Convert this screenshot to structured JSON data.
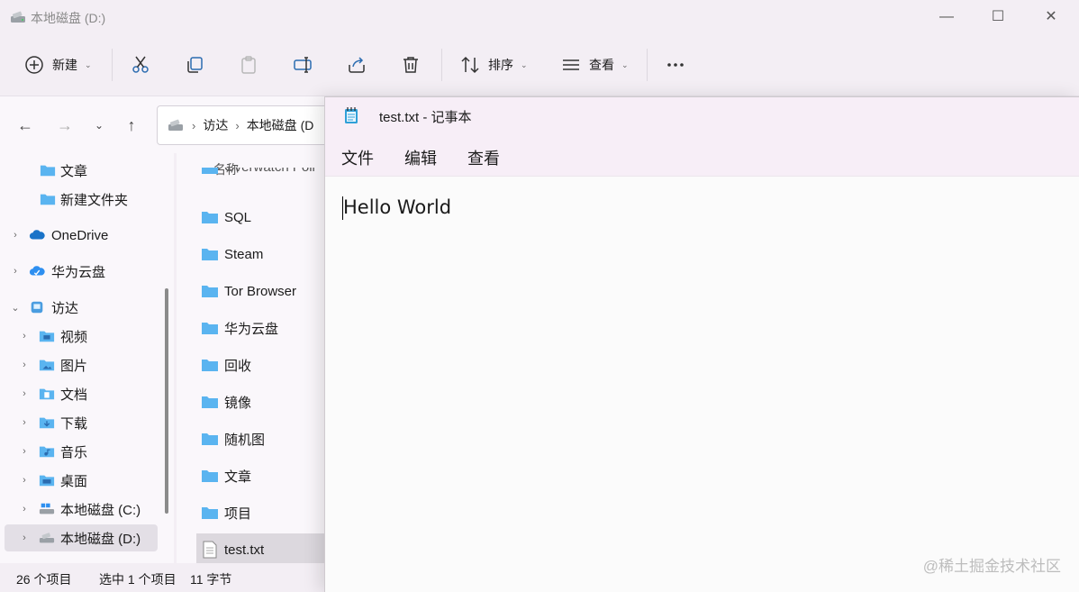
{
  "explorer": {
    "title": "本地磁盘 (D:)",
    "toolbar": {
      "new_label": "新建",
      "sort_label": "排序",
      "view_label": "查看",
      "icons": [
        "plus-circle-icon",
        "cut-icon",
        "copy-icon",
        "paste-icon",
        "rename-icon",
        "share-icon",
        "delete-icon",
        "sort-icon",
        "view-icon",
        "more-icon"
      ]
    },
    "address": {
      "segments": [
        "访达",
        "本地磁盘 (D"
      ]
    },
    "sidebar": {
      "items": [
        {
          "label": "文章",
          "icon": "folder-icon"
        },
        {
          "label": "新建文件夹",
          "icon": "folder-icon"
        },
        {
          "label": "OneDrive",
          "icon": "cloud-icon"
        },
        {
          "label": "华为云盘",
          "icon": "cloud-icon"
        },
        {
          "label": "访达",
          "icon": "computer-icon"
        },
        {
          "label": "视频",
          "icon": "video-folder-icon"
        },
        {
          "label": "图片",
          "icon": "pictures-folder-icon"
        },
        {
          "label": "文档",
          "icon": "documents-folder-icon"
        },
        {
          "label": "下载",
          "icon": "downloads-folder-icon"
        },
        {
          "label": "音乐",
          "icon": "music-folder-icon"
        },
        {
          "label": "桌面",
          "icon": "desktop-folder-icon"
        },
        {
          "label": "本地磁盘 (C:)",
          "icon": "drive-icon"
        },
        {
          "label": "本地磁盘 (D:)",
          "icon": "drive-icon"
        }
      ]
    },
    "filelist": {
      "column_name": "名称",
      "partial_top": "Overwatch Poli",
      "files": [
        {
          "label": "SQL",
          "icon": "folder-icon"
        },
        {
          "label": "Steam",
          "icon": "folder-icon"
        },
        {
          "label": "Tor Browser",
          "icon": "folder-icon"
        },
        {
          "label": "华为云盘",
          "icon": "folder-icon"
        },
        {
          "label": "回收",
          "icon": "folder-icon"
        },
        {
          "label": "镜像",
          "icon": "folder-icon"
        },
        {
          "label": "随机图",
          "icon": "folder-icon"
        },
        {
          "label": "文章",
          "icon": "folder-icon"
        },
        {
          "label": "项目",
          "icon": "folder-icon"
        },
        {
          "label": "test.txt",
          "icon": "text-file-icon"
        }
      ]
    },
    "status": {
      "count": "26 个项目",
      "selected": "选中 1 个项目",
      "size": "11 字节"
    }
  },
  "notepad": {
    "title": "test.txt - 记事本",
    "menu": [
      "文件",
      "编辑",
      "查看"
    ],
    "content": "Hello World"
  },
  "watermark": "@稀土掘金技术社区",
  "colors": {
    "folder": "#5ab4f0",
    "onedrive": "#1a73c8"
  }
}
